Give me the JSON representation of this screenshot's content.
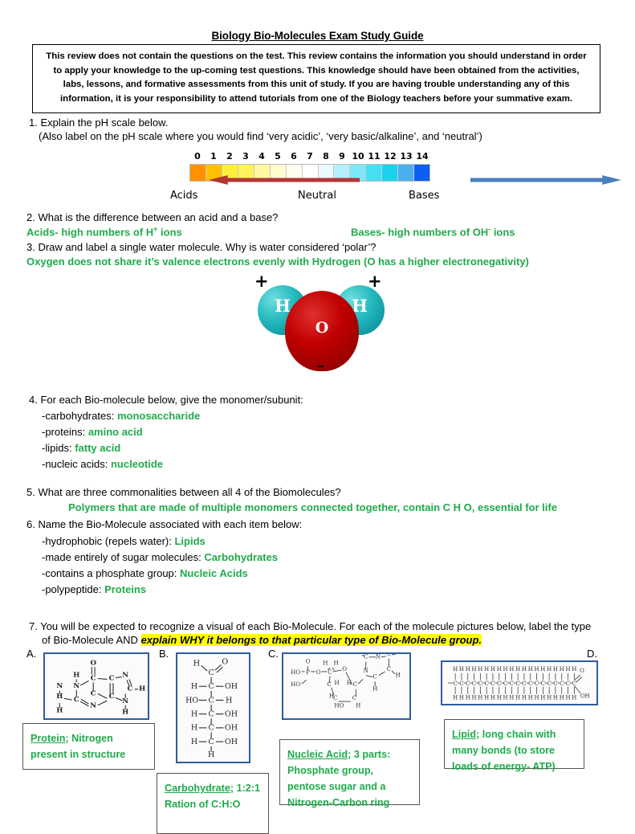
{
  "document": {
    "title": "Biology Bio-Molecules Exam Study Guide",
    "notice": "This review does not contain the questions on the test.  This review contains the information you should understand in order to apply your knowledge to the up-coming test questions.  This knowledge should have been obtained from the activities, labs, lessons, and formative assessments from this unit of study.  If you are having trouble understanding any of this information, it is your responsibility to attend tutorials from one of the Biology teachers before your summative exam."
  },
  "q1": {
    "prompt": "1.  Explain the pH scale below.",
    "subprompt": "(Also label on the pH scale where you would find ‘very acidic’, ‘very basic/alkaline’, and ‘neutral’)",
    "ph_scale": {
      "ticks": [
        "0",
        "1",
        "2",
        "3",
        "4",
        "5",
        "6",
        "7",
        "8",
        "9",
        "10",
        "11",
        "12",
        "13",
        "14"
      ],
      "label_acids": "Acids",
      "label_neutral": "Neutral",
      "label_bases": "Bases",
      "acid_arrow_color": "#b33636",
      "base_arrow_color": "#4a7fbd",
      "cell_colors": [
        "#ff9000",
        "#ffc000",
        "#ffef3a",
        "#fff35c",
        "#fff8a0",
        "#fffbcc",
        "#fffdee",
        "#ffffff",
        "#eafaff",
        "#b4f0fb",
        "#7ee8f7",
        "#46dff5",
        "#1ad2ef",
        "#49b0f0",
        "#0b5ff5"
      ]
    }
  },
  "q2": {
    "prompt": "2.  What is the difference between an acid and a base?",
    "answer_left_pre": "Acids- high numbers of H",
    "answer_left_sup": "+",
    "answer_left_post": " ions",
    "answer_right_pre": "Bases- high numbers of OH",
    "answer_right_sup": "-",
    "answer_right_post": " ions"
  },
  "q3": {
    "prompt": "3.  Draw and label a single water molecule. Why is water considered ‘polar’?",
    "answer": "Oxygen does not share it’s valence electrons evenly with Hydrogen (O has a higher electronegativity)",
    "water_molecule": {
      "hydrogen_label": "H",
      "oxygen_label": "O",
      "partial_positive": "+",
      "partial_negative": "–",
      "hydrogen_color": "#23b8bd",
      "oxygen_color": "#c00000"
    }
  },
  "q4": {
    "prompt": "4.  For each Bio-molecule below, give the monomer/subunit:",
    "items": [
      {
        "label": "-carbohydrates: ",
        "answer": "monosaccharide"
      },
      {
        "label": "-proteins: ",
        "answer": "amino acid"
      },
      {
        "label": "-lipids: ",
        "answer": "fatty acid"
      },
      {
        "label": "-nucleic acids: ",
        "answer": "nucleotide"
      }
    ]
  },
  "q5": {
    "prompt": "5. What are three commonalities between all 4 of the Biomolecules?",
    "answer": "Polymers that are made of multiple monomers connected together, contain C H O, essential for life"
  },
  "q6": {
    "prompt": "6.  Name the Bio-Molecule associated with each item below:",
    "items": [
      {
        "label": "-hydrophobic (repels water): ",
        "answer": "Lipids"
      },
      {
        "label": "-made entirely of sugar molecules: ",
        "answer": "Carbohydrates"
      },
      {
        "label": "-contains a phosphate group: ",
        "answer": "Nucleic Acids"
      },
      {
        "label": "-polypeptide: ",
        "answer": "Proteins"
      }
    ]
  },
  "q7": {
    "prompt_line1": "7.  You will be expected to recognize a visual of each Bio-Molecule.  For each of the molecule pictures below, label the type",
    "prompt_line2_pre": "of Bio-Molecule AND ",
    "prompt_line2_highlight": "explain WHY it belongs to that particular type of Bio-Molecule group.",
    "items": [
      {
        "letter": "A.",
        "structure": "guanine-purine-ring",
        "answer_underlined": "Protein",
        "answer_rest": "; Nitrogen present in structure"
      },
      {
        "letter": "B.",
        "structure": "glucose-fischer-projection",
        "answer_underlined": "Carbohydrate",
        "answer_rest": "; 1:2:1 Ration of C:H:O"
      },
      {
        "letter": "C.",
        "structure": "nucleotide-phosphate-sugar-base",
        "answer_underlined": "Nucleic Acid",
        "answer_rest": "; 3 parts: Phosphate group, pentose sugar and a Nitrogen-Carbon ring"
      },
      {
        "letter": "D.",
        "structure": "fatty-acid-hydrocarbon-chain",
        "answer_underlined": "Lipid",
        "answer_rest": "; long chain with many bonds (to store loads of energy- ATP)"
      }
    ]
  }
}
